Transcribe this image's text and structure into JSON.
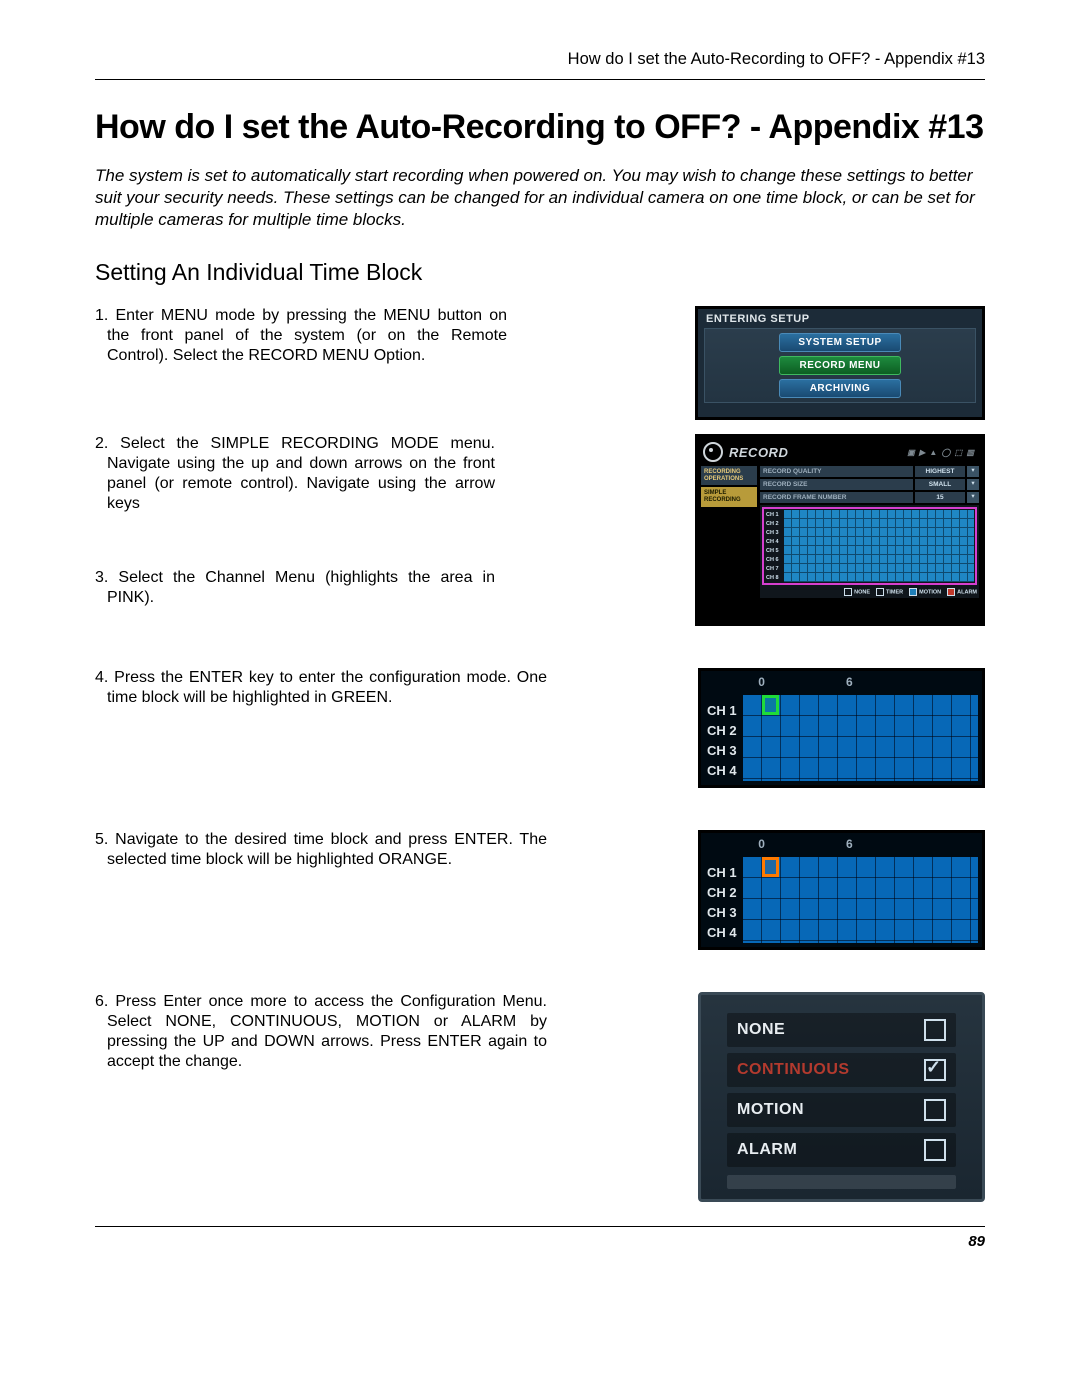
{
  "running_head": "How do I set the Auto-Recording to OFF? - Appendix #13",
  "title": "How do I set the Auto-Recording to OFF? - Appendix #13",
  "intro": "The system is set to automatically start recording when powered on. You may wish to change these settings to better suit your security needs. These settings can be changed for an individual camera on one time block, or can be set for multiple cameras for multiple time blocks.",
  "section_head": "Setting An Individual Time Block",
  "steps": {
    "s1": "1. Enter MENU mode by pressing the MENU button on the front panel of the system (or on the Remote Control). Select the RECORD MENU Option.",
    "s2": "2. Select the SIMPLE RECORDING MODE menu. Navigate using the up and down arrows on the front panel (or remote control). Navigate using the arrow keys",
    "s3": "3. Select the Channel Menu (highlights the area in PINK).",
    "s4": "4. Press the ENTER key to enter the configuration mode. One time block will be highlighted in GREEN.",
    "s5": "5. Navigate to the desired time block and press ENTER. The selected time block will be highlighted ORANGE.",
    "s6": "6. Press Enter once more to access the Configuration Menu. Select NONE, CONTINUOUS, MOTION or ALARM by pressing the UP and DOWN arrows. Press ENTER again to accept the change."
  },
  "fig1": {
    "title": "ENTERING SETUP",
    "items": [
      "SYSTEM SETUP",
      "RECORD MENU",
      "ARCHIVING"
    ]
  },
  "fig2": {
    "title": "RECORD",
    "tabs": {
      "a": "RECORDING\nOPERATIONS",
      "b": "SIMPLE\nRECORDING"
    },
    "settings": {
      "quality": {
        "label": "RECORD QUALITY",
        "value": "HIGHEST"
      },
      "size": {
        "label": "RECORD SIZE",
        "value": "SMALL"
      },
      "frame": {
        "label": "RECORD FRAME NUMBER",
        "value": "15"
      }
    },
    "channels": [
      "CH 1",
      "CH 2",
      "CH 3",
      "CH 4",
      "CH 5",
      "CH 6",
      "CH 7",
      "CH 8"
    ],
    "legend": [
      "NONE",
      "TIMER",
      "MOTION",
      "ALARM"
    ]
  },
  "fig34": {
    "axis": {
      "a": "0",
      "b": "6"
    },
    "channels": [
      "CH 1",
      "CH 2",
      "CH 3",
      "CH 4"
    ]
  },
  "fig5": {
    "options": [
      "NONE",
      "CONTINUOUS",
      "MOTION",
      "ALARM"
    ],
    "checked_index": 1
  },
  "page_number": "89"
}
